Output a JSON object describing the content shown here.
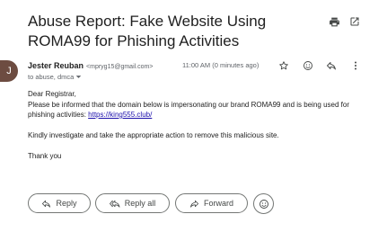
{
  "email": {
    "subject": "Abuse Report: Fake Website Using ROMA99 for Phishing Activities",
    "sender_initial": "J",
    "sender_name": "Jester Reuban",
    "sender_email": "<mpryg15@gmail.com>",
    "to_line": "to abuse, dmca",
    "time": "11:00 AM (0 minutes ago)",
    "body": {
      "greeting": "Dear Registrar,",
      "para1": "Please be informed that the domain below is impersonating our brand ROMA99 and is being used for phishing activities:",
      "link": "https://king555.club/",
      "para2": "Kindly investigate and take the appropriate action to remove this malicious site.",
      "closing": "Thank you"
    }
  },
  "actions": {
    "reply": "Reply",
    "reply_all": "Reply all",
    "forward": "Forward"
  },
  "icons": {
    "print": "print-icon",
    "open_new_window": "open-in-new-window-icon",
    "star": "star-icon",
    "emoji": "emoji-reaction-icon",
    "reply": "reply-icon",
    "more": "more-vert-icon",
    "to_dropdown": "chevron-down-icon"
  },
  "colors": {
    "avatar": "#6d4c41",
    "link": "#1a0dab",
    "button_border": "#747775"
  }
}
